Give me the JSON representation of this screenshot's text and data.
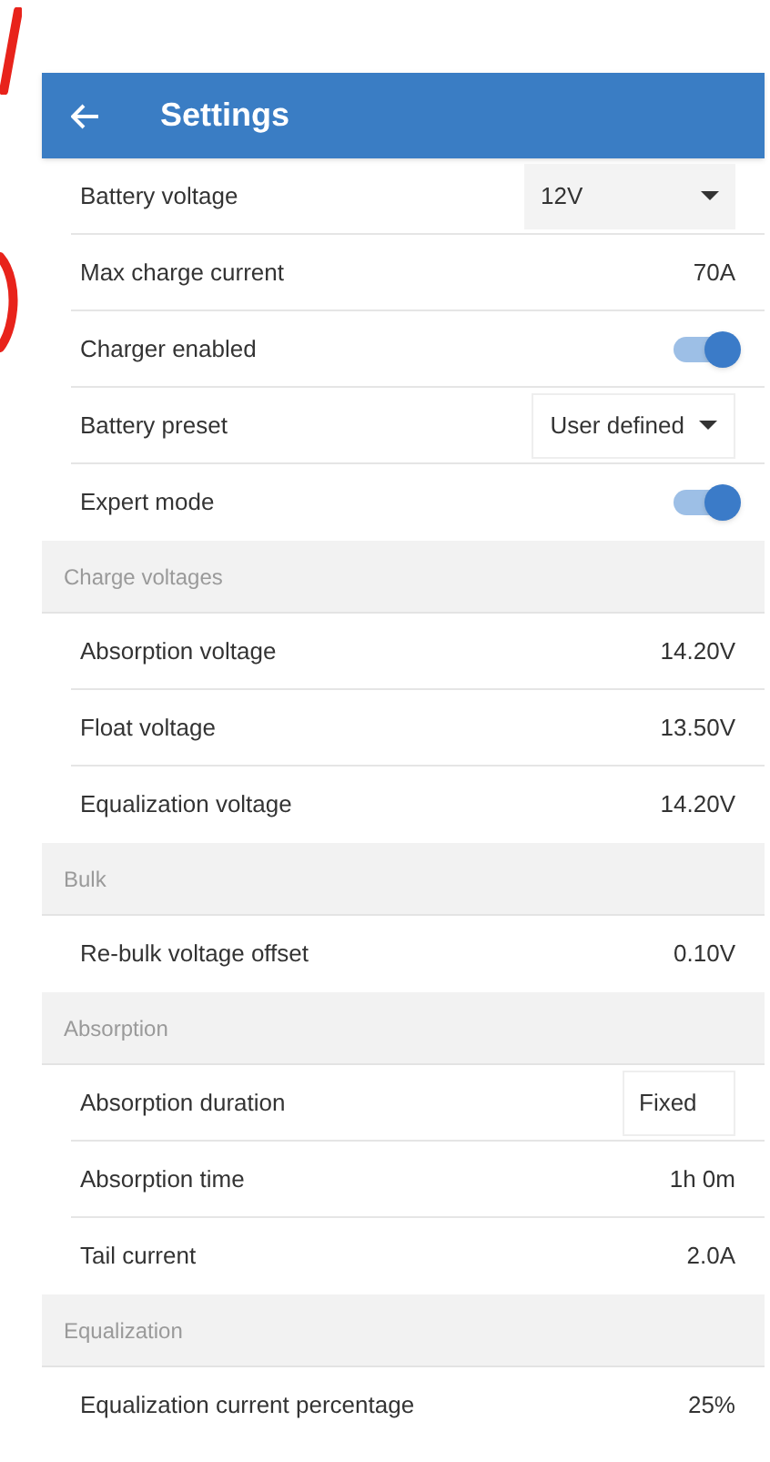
{
  "header": {
    "title": "Settings"
  },
  "sections": [
    {
      "items": [
        {
          "kind": "dropdown",
          "label": "Battery voltage",
          "value": "12V",
          "filled": true
        },
        {
          "kind": "value",
          "label": "Max charge current",
          "value": "70A"
        },
        {
          "kind": "toggle",
          "label": "Charger enabled",
          "on": true
        },
        {
          "kind": "dropdown",
          "label": "Battery preset",
          "value": "User defined",
          "filled": false
        },
        {
          "kind": "toggle",
          "label": "Expert mode",
          "on": true
        }
      ]
    },
    {
      "title": "Charge voltages",
      "items": [
        {
          "kind": "value",
          "label": "Absorption voltage",
          "value": "14.20V"
        },
        {
          "kind": "value",
          "label": "Float voltage",
          "value": "13.50V"
        },
        {
          "kind": "value",
          "label": "Equalization voltage",
          "value": "14.20V"
        }
      ]
    },
    {
      "title": "Bulk",
      "items": [
        {
          "kind": "value",
          "label": "Re-bulk voltage offset",
          "value": "0.10V"
        }
      ]
    },
    {
      "title": "Absorption",
      "items": [
        {
          "kind": "choice",
          "label": "Absorption duration",
          "value": "Fixed"
        },
        {
          "kind": "value",
          "label": "Absorption time",
          "value": "1h 0m"
        },
        {
          "kind": "value",
          "label": "Tail current",
          "value": "2.0A"
        }
      ]
    },
    {
      "title": "Equalization",
      "items": [
        {
          "kind": "value",
          "label": "Equalization current percentage",
          "value": "25%"
        }
      ]
    }
  ]
}
